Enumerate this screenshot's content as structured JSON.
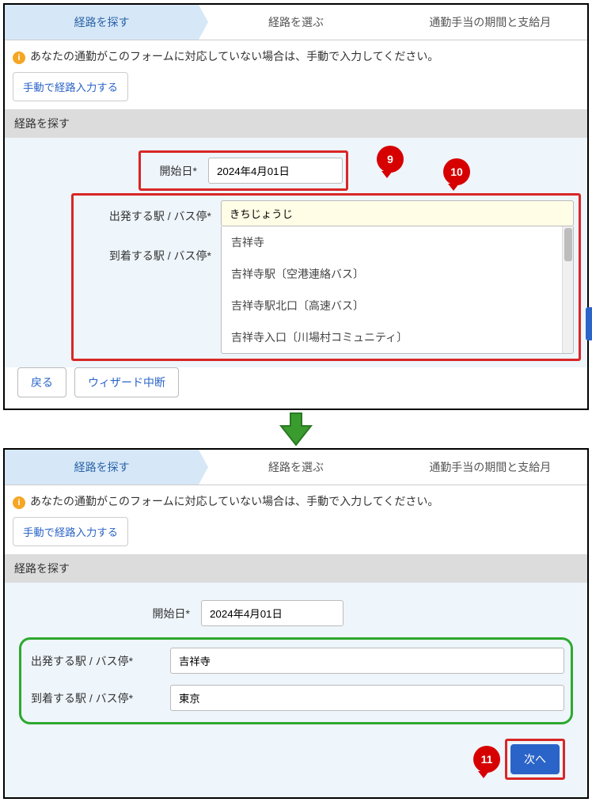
{
  "steps": {
    "s1": "経路を探す",
    "s2": "経路を選ぶ",
    "s3": "通勤手当の期間と支給月"
  },
  "info_text": "あなたの通勤がこのフォームに対応していない場合は、手動で入力してください。",
  "manual_button": "手動で経路入力する",
  "section_title": "経路を探す",
  "labels": {
    "start_date": "開始日*",
    "from": "出発する駅 / バス停*",
    "to": "到着する駅 / バス停*"
  },
  "panel1": {
    "date": "2024年4月01日",
    "from_input": "きちじょうじ",
    "suggestions": [
      "吉祥寺",
      "吉祥寺駅〔空港連絡バス〕",
      "吉祥寺駅北口〔高速バス〕",
      "吉祥寺入口〔川場村コミュニティ〕"
    ]
  },
  "panel2": {
    "date": "2024年4月01日",
    "from": "吉祥寺",
    "to": "東京"
  },
  "buttons": {
    "back": "戻る",
    "cancel": "ウィザード中断",
    "next": "次へ"
  },
  "callouts": {
    "c9": "9",
    "c10": "10",
    "c11": "11"
  }
}
